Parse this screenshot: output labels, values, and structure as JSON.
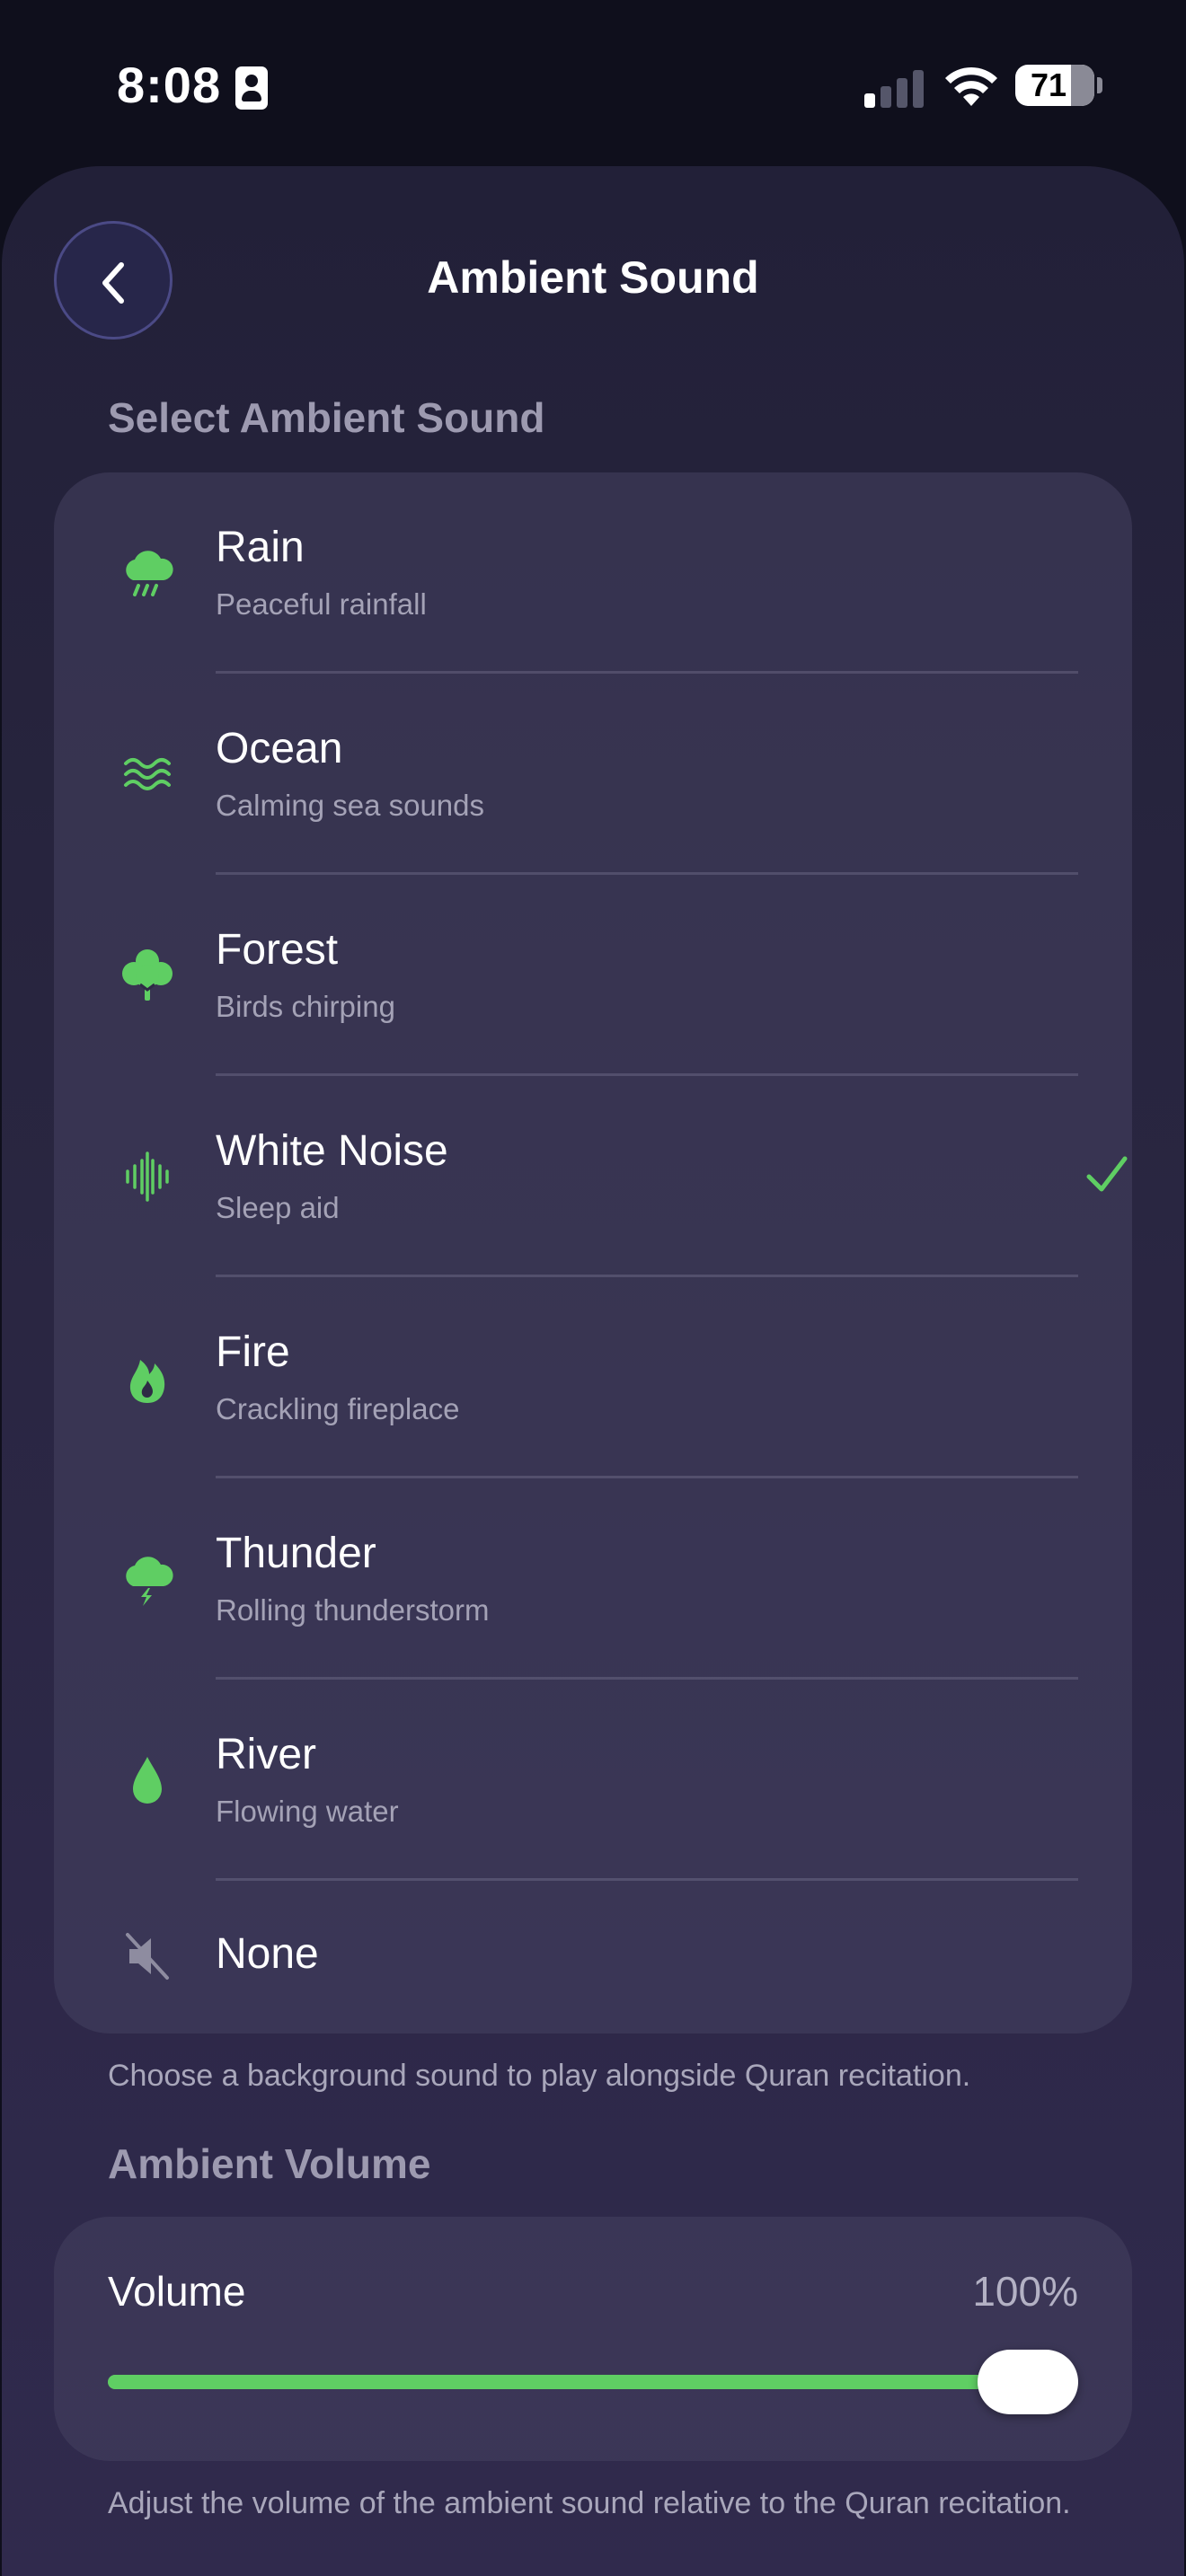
{
  "status_bar": {
    "time": "8:08",
    "battery": "71",
    "battery_level": 0.71
  },
  "header": {
    "title": "Ambient Sound",
    "back_icon": "chevron-left-icon"
  },
  "sound_section": {
    "label": "Select Ambient Sound",
    "items": [
      {
        "key": "rain",
        "name": "Rain",
        "description": "Peaceful rainfall",
        "icon": "cloud-rain-icon",
        "selected": false
      },
      {
        "key": "ocean",
        "name": "Ocean",
        "description": "Calming sea sounds",
        "icon": "waves-icon",
        "selected": false
      },
      {
        "key": "forest",
        "name": "Forest",
        "description": "Birds chirping",
        "icon": "tree-icon",
        "selected": false
      },
      {
        "key": "white-noise",
        "name": "White Noise",
        "description": "Sleep aid",
        "icon": "waveform-icon",
        "selected": true
      },
      {
        "key": "fire",
        "name": "Fire",
        "description": "Crackling fireplace",
        "icon": "flame-icon",
        "selected": false
      },
      {
        "key": "thunder",
        "name": "Thunder",
        "description": "Rolling thunderstorm",
        "icon": "cloud-bolt-icon",
        "selected": false
      },
      {
        "key": "river",
        "name": "River",
        "description": "Flowing water",
        "icon": "drop-icon",
        "selected": false
      },
      {
        "key": "none",
        "name": "None",
        "description": "",
        "icon": "speaker-mute-icon",
        "selected": false
      }
    ],
    "footnote": "Choose a background sound to play alongside Quran recitation."
  },
  "volume_section": {
    "label": "Ambient Volume",
    "volume_label": "Volume",
    "volume_value_text": "100%",
    "volume_level": 1.0,
    "footnote": "Adjust the volume of the ambient sound relative to the Quran recitation."
  },
  "colors": {
    "accent": "#5fce63",
    "muted_icon": "#8e8ca0",
    "background": "#0f0f1c"
  }
}
